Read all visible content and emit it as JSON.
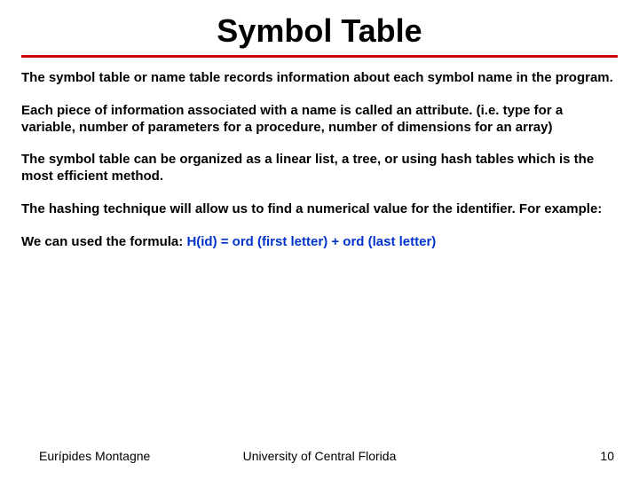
{
  "title": "Symbol Table",
  "paragraphs": {
    "p1": "The symbol table or name table records information about each symbol name in the program.",
    "p2": "Each  piece of information associated  with a name is called an attribute. (i.e. type for a variable, number of parameters for a procedure, number of dimensions for an array)",
    "p3": "The symbol table can be organized as a linear list, a tree, or using hash tables which is the most efficient method.",
    "p4": "The hashing technique will allow us to find a numerical value for the identifier. For example:",
    "p5_prefix": "We can  used the formula: ",
    "p5_formula": "H(id) = ord (first letter) + ord (last letter)"
  },
  "footer": {
    "author": "Eurípides Montagne",
    "affiliation": "University of Central Florida",
    "page_number": "10"
  }
}
